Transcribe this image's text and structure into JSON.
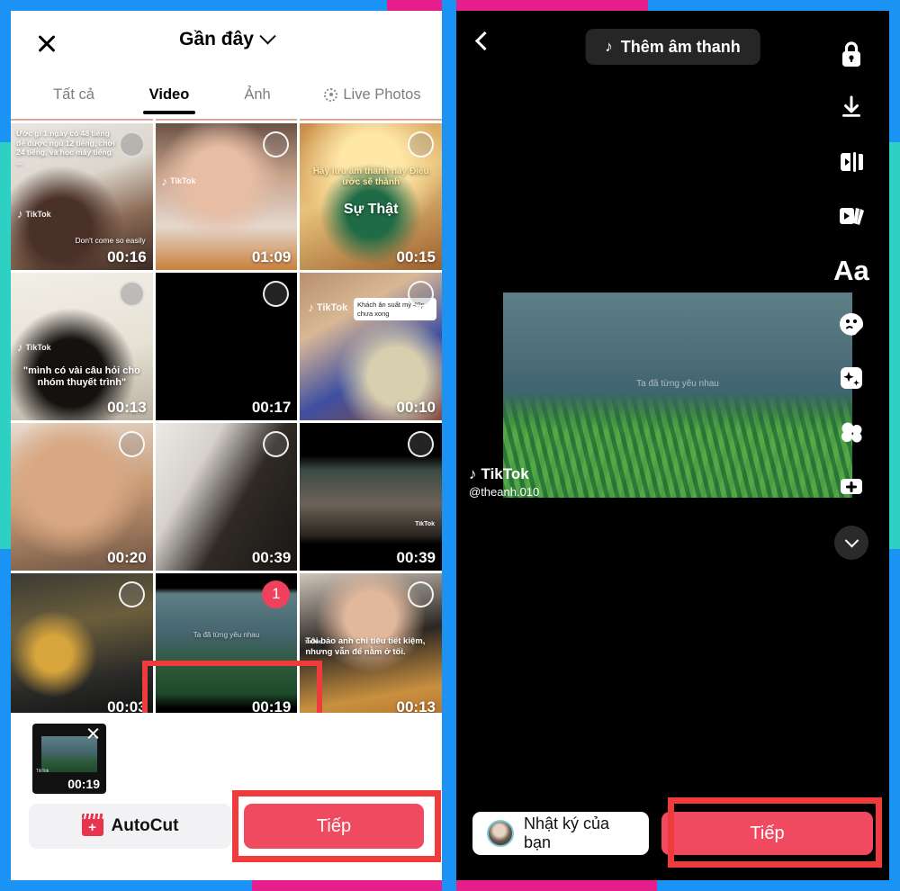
{
  "frame": {
    "blue": "#1b93f5",
    "pink": "#e61e8c",
    "teal": "#2ed0c4",
    "annotation_red": "#ef3b3b"
  },
  "left_panel": {
    "close_icon": "close-x-icon",
    "album_title": "Gần đây",
    "album_chevron_icon": "chevron-down-icon",
    "tabs": [
      {
        "label": "Tất cả",
        "active": false,
        "icon": null
      },
      {
        "label": "Video",
        "active": true,
        "icon": null
      },
      {
        "label": "Ảnh",
        "active": false,
        "icon": null
      },
      {
        "label": "Live Photos",
        "active": false,
        "icon": "live-photos-icon"
      }
    ],
    "grid": {
      "rows": [
        {
          "cells": [
            {
              "duration": "00:16",
              "caption": "Ước gì 1 ngày có 48 tiếng để được ngủ 12 tiếng, chơi 24 tiếng, và học mấy tiếng ...",
              "caption2": "Don't come so easily",
              "watermark": "TikTok",
              "selected": false,
              "art": "art-a",
              "circle": "gray"
            },
            {
              "duration": "01:09",
              "caption": "",
              "watermark": "TikTok",
              "selected": false,
              "art": "art-b",
              "circle": "white"
            },
            {
              "duration": "00:15",
              "caption": "Hãy lưu âm thanh này Điều ước sẽ thành",
              "caption2": "Sự Thật",
              "watermark": "",
              "selected": false,
              "art": "art-c",
              "circle": "white"
            }
          ]
        },
        {
          "cells": [
            {
              "duration": "00:13",
              "caption": "\"mình có vài câu hỏi cho nhóm thuyết trình\"",
              "watermark": "TikTok",
              "selected": false,
              "art": "art-d",
              "circle": "gray"
            },
            {
              "duration": "00:17",
              "caption": "",
              "watermark": "",
              "selected": false,
              "art": "art-e",
              "circle": "white"
            },
            {
              "duration": "00:10",
              "caption": "Khách ăn suất mỳ 40p chưa xong",
              "watermark": "TikTok",
              "selected": false,
              "art": "art-f",
              "circle": "white"
            }
          ]
        },
        {
          "cells": [
            {
              "duration": "00:20",
              "caption": "",
              "watermark": "",
              "selected": false,
              "art": "art-g",
              "circle": "white"
            },
            {
              "duration": "00:39",
              "caption": "",
              "watermark": "",
              "selected": false,
              "art": "art-h",
              "circle": "white"
            },
            {
              "duration": "00:39",
              "caption": "",
              "watermark": "TikTok",
              "selected": false,
              "art": "art-i",
              "circle": "white"
            }
          ]
        },
        {
          "cells": [
            {
              "duration": "00:03",
              "caption": "",
              "watermark": "",
              "selected": false,
              "art": "art-j",
              "circle": "white"
            },
            {
              "duration": "00:19",
              "caption": "Ta đã từng yêu nhau",
              "watermark": "",
              "selected": true,
              "badge": "1",
              "art": "art-k",
              "circle": "badge"
            },
            {
              "duration": "00:13",
              "caption": "Tôi bảo anh chi tiêu tiết kiệm, nhưng vẫn để nằm ở tối.",
              "watermark": "TikTok",
              "selected": false,
              "art": "art-l",
              "circle": "white"
            }
          ]
        }
      ]
    },
    "tray": {
      "thumb_duration": "00:19",
      "remove_icon": "close-x-icon",
      "autocut_label": "AutoCut",
      "autocut_icon": "clapperboard-icon",
      "next_label": "Tiếp"
    }
  },
  "right_panel": {
    "back_icon": "chevron-left-icon",
    "add_sound_label": "Thêm âm thanh",
    "music_icon": "music-note-icon",
    "side_buttons": [
      {
        "name": "privacy-lock",
        "icon": "lock-icon",
        "label": ""
      },
      {
        "name": "download",
        "icon": "download-icon",
        "label": ""
      },
      {
        "name": "split-clip",
        "icon": "split-screen-icon",
        "label": ""
      },
      {
        "name": "clips",
        "icon": "clips-stack-icon",
        "label": ""
      },
      {
        "name": "text",
        "icon": "text-aa-icon",
        "label": "Aa"
      },
      {
        "name": "stickers",
        "icon": "sticker-icon",
        "label": ""
      },
      {
        "name": "effects",
        "icon": "sparkle-effects-icon",
        "label": ""
      },
      {
        "name": "filters",
        "icon": "filters-icon",
        "label": ""
      },
      {
        "name": "overlay",
        "icon": "add-overlay-icon",
        "label": ""
      },
      {
        "name": "collapse",
        "icon": "chevron-down-icon",
        "label": ""
      }
    ],
    "preview": {
      "caption": "Ta đã từng yêu nhau",
      "watermark_brand": "TikTok",
      "watermark_user": "@theanh.010"
    },
    "bottom": {
      "diary_label": "Nhật ký của bạn",
      "avatar_icon": "avatar",
      "next_label": "Tiếp"
    }
  }
}
